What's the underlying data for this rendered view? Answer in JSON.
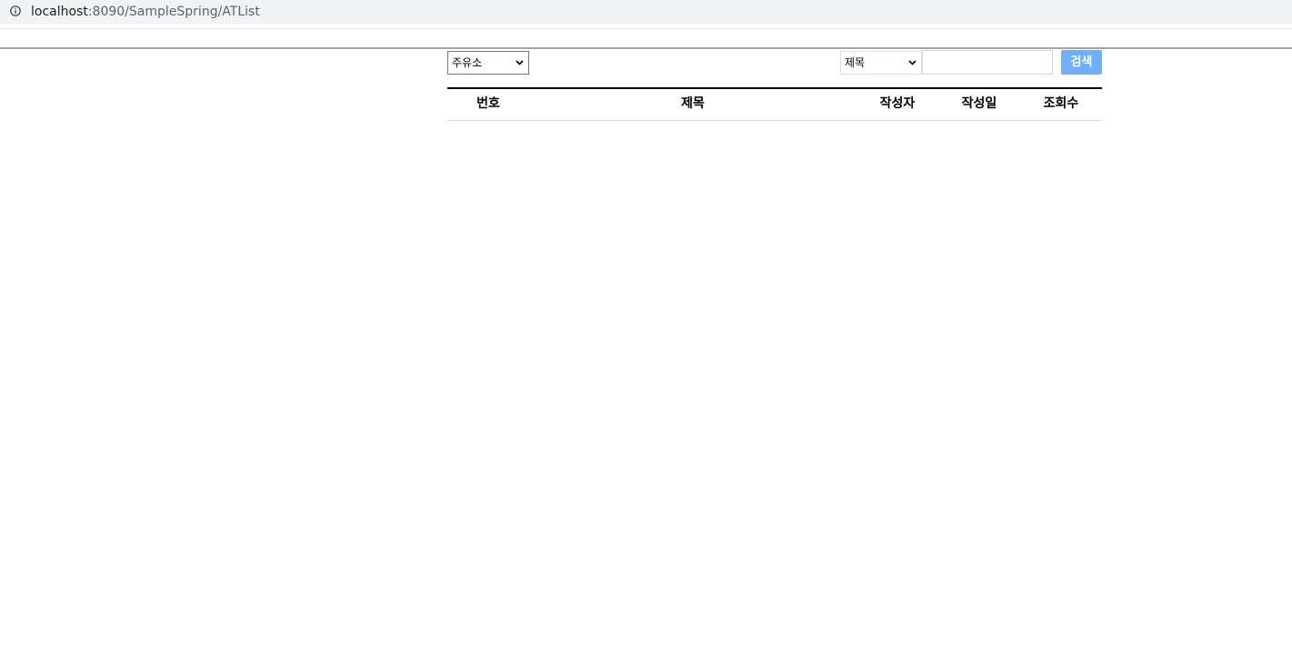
{
  "browser": {
    "url_host": "localhost",
    "url_rest": ":8090/SampleSpring/ATList",
    "info_icon": "info-circle-icon"
  },
  "toolbar": {
    "board_select": {
      "selected": "주유소",
      "options": [
        "주유소"
      ]
    },
    "search_type_select": {
      "selected": "제목",
      "options": [
        "제목"
      ]
    },
    "search_input": {
      "value": "",
      "placeholder": ""
    },
    "search_button_label": "검색",
    "search_button_color": "#6eb0ff"
  },
  "table": {
    "columns": [
      "번호",
      "제목",
      "작성자",
      "작성일",
      "조회수"
    ],
    "rows": []
  }
}
